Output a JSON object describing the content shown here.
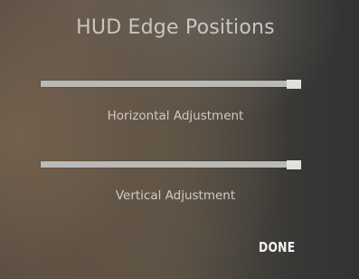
{
  "dialog": {
    "title": "HUD Edge Positions",
    "horizontal": {
      "label": "Horizontal Adjustment",
      "value": 1.0
    },
    "vertical": {
      "label": "Vertical Adjustment",
      "value": 1.0
    },
    "done_label": "DONE"
  }
}
